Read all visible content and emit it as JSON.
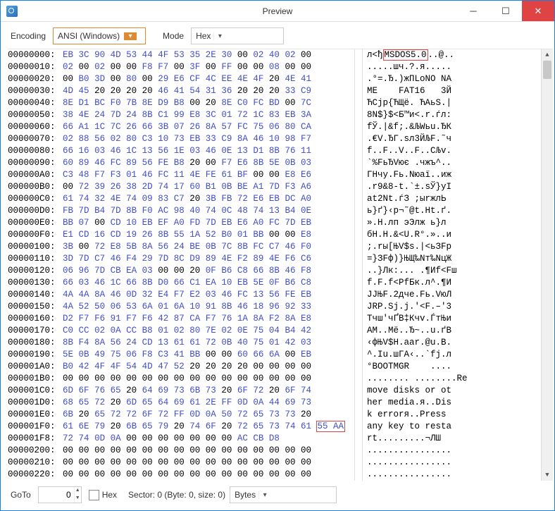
{
  "window": {
    "title": "Preview",
    "minimize_tip": "Minimize",
    "maximize_tip": "Maximize",
    "close_tip": "Close"
  },
  "toolbar": {
    "encoding_label": "Encoding",
    "encoding_value": "ANSI (Windows)",
    "mode_label": "Mode",
    "mode_value": "Hex"
  },
  "footer": {
    "goto_label": "GoTo",
    "goto_value": "0",
    "hex_label": "Hex",
    "sector_label": "Sector: 0 (Byte: 0, size: 0)",
    "unit_value": "Bytes"
  },
  "highlights": {
    "msdos_row_index": 0,
    "msdos_text": "MSDOS5.0",
    "sig_row_index": 31,
    "sig_hex": "55 AA"
  },
  "rows": [
    {
      "o": "00000000:",
      "h": "EB 3C 90 4D 53 44 4F 53  35 2E 30 00 02 40 02 00",
      "a": "л<ђMSDOS5.0..@.."
    },
    {
      "o": "00000010:",
      "h": "02 00 02 00 00 F8 F7 00  3F 00 FF 00 00 08 00 00",
      "a": ".....шч.?.я....."
    },
    {
      "o": "00000020:",
      "h": "00 B0 3D 00 80 00 29 E6  CF 4C EE 4E 4F 20 4E 41",
      "a": ".°=.Ђ.)жПLоNO NA"
    },
    {
      "o": "00000030:",
      "h": "4D 45 20 20 20 20 46 41  54 31 36 20 20 20 33 C9",
      "a": "ME    FAT16   3Й"
    },
    {
      "o": "00000040:",
      "h": "8E D1 BC F0 7B 8E D9 B8  00 20 8E C0 FC BD 00 7C",
      "a": "ЋСjр{ЋЩё. ЋАьS.|"
    },
    {
      "o": "00000050:",
      "h": "38 4E 24 7D 24 8B C1 99  E8 3C 01 72 1C 83 EB 3A",
      "a": "8N$}$<Б™и<.r.ѓл:"
    },
    {
      "o": "00000060:",
      "h": "66 A1 1C 7C 26 66 3B 07  26 8A 57 FC 75 06 80 CA",
      "a": "fЎ.|&f;.&ЉWьu.ЂК"
    },
    {
      "o": "00000070:",
      "h": "02 88 56 02 80 C3 10 73  EB 33 C9 8A 46 10 98 F7",
      "a": ".€V.ЂГ.sл3ЙЉF.˜ч"
    },
    {
      "o": "00000080:",
      "h": "66 16 03 46 1C 13 56 1E  03 46 0E 13 D1 8B 76 11",
      "a": "f..F..V..F..СЉv."
    },
    {
      "o": "00000090:",
      "h": "60 89 46 FC 89 56 FE B8  20 00 F7 E6 8B 5E 0B 03",
      "a": "`%FьЂVює .чжъ^.."
    },
    {
      "o": "000000A0:",
      "h": "C3 48 F7 F3 01 46 FC 11  4E FE 61 BF 00 00 E8 E6",
      "a": "ГHчу.Fь.Nюаї..иж"
    },
    {
      "o": "000000B0:",
      "h": "00 72 39 26 38 2D 74 17  60 B1 0B BE A1 7D F3 A6",
      "a": ".r9&8-t.`±.ѕЎ}уІ"
    },
    {
      "o": "000000C0:",
      "h": "61 74 32 4E 74 09 83 C7  20 3B FB 72 E6 EB DC A0",
      "a": "at2Nt.ѓЗ ;ыrжлЬ "
    },
    {
      "o": "000000D0:",
      "h": "FB 7D B4 7D 8B F0 AC 98  40 74 0C 48 74 13 B4 0E",
      "a": "ь}ґ}‹р¬˜@t.Ht.ґ."
    },
    {
      "o": "000000E0:",
      "h": "BB 07 00 CD 10 EB EF A0  FD 7D EB E6 A0 FC 7D EB",
      "a": "».Н.лп эЭлж ь}л"
    },
    {
      "o": "000000F0:",
      "h": "E1 CD 16 CD 19 26 8B 55  1A 52 B0 01 BB 00 00 E8",
      "a": "бН.Н.&<U.R°.»..и"
    },
    {
      "o": "00000100:",
      "h": "3B 00 72 E8 5B 8A 56 24  BE 0B 7C 8B FC C7 46 F0",
      "a": ";.rы[ЊV$ѕ.|<ьЗFр"
    },
    {
      "o": "00000110:",
      "h": "3D 7D C7 46 F4 29 7D 8C  D9 89 4E F2 89 4E F6 C6",
      "a": "=}ЗFф)}ЊЩ‰Nт‰NцЖ"
    },
    {
      "o": "00000120:",
      "h": "06 96 7D CB EA 03 00 00  20 0F B6 C8 66 8B 46 F8",
      "a": "..}Лк:... .¶Иf<Fш"
    },
    {
      "o": "00000130:",
      "h": "66 03 46 1C 66 8B D0 66  C1 EA 10 EB 5E 0F B6 C8",
      "a": "f.F.f<РfБк.л^.¶И"
    },
    {
      "o": "00000140:",
      "h": "4A 4A 8A 46 0D 32 E4 F7  E2 03 46 FC 13 56 FE EB",
      "a": "JJЊF.2дче.Fь.VюЛ"
    },
    {
      "o": "00000150:",
      "h": "4A 52 50 06 53 6A 01 6A  10 91 8B 46 18 96 92 33",
      "a": "JRP.Sj.j.'<F.–'3"
    },
    {
      "o": "00000160:",
      "h": "D2 F7 F6 91 F7 F6 42 87  CA F7 76 1A 8A F2 8A E8",
      "a": "Тчш'чҐВ‡Кчv.ЃтЊи"
    },
    {
      "o": "00000170:",
      "h": "C0 CC 02 0A CC B8 01 02  80 7E 02 0E 75 04 B4 42",
      "a": "АМ..Мё..Ђ~..u.ґВ"
    },
    {
      "o": "00000180:",
      "h": "8B F4 8A 56 24 CD 13 61  61 72 0B 40 75 01 42 03",
      "a": "‹фЊV$Н.aar.@u.B."
    },
    {
      "o": "00000190:",
      "h": "5E 0B 49 75 06 F8 C3 41  BB 00 00 60 66 6A 00 EB",
      "a": "^.Iu.шГА‹..`fj.л"
    },
    {
      "o": "000001A0:",
      "h": "B0 42 4F 4F 54 4D 47 52  20 20 20 20 00 00 00 00",
      "a": "°BOOTMGR    ...."
    },
    {
      "o": "000001B0:",
      "h": "00 00 00 00 00 00 00 00  00 00 00 00 00 00 00 00",
      "a": "........ ........Re"
    },
    {
      "o": "000001C0:",
      "h": "6D 6F 76 65 20 64 69 73  6B 73 20 6F 72 20 6F 74",
      "a": "move disks or ot"
    },
    {
      "o": "000001D0:",
      "h": "68 65 72 20 6D 65 64 69  61 2E FF 0D 0A 44 69 73",
      "a": "her media.я..Dis"
    },
    {
      "o": "000001E0:",
      "h": "6B 20 65 72 72 6F 72 FF  0D 0A 50 72 65 73 73 20",
      "a": "k errorя..Press "
    },
    {
      "o": "000001F0:",
      "h": "61 6E 79 20 6B 65 79 20  74 6F 20 72 65 73 74 61",
      "a": "any key to resta"
    },
    {
      "o": "000001F8:",
      "h": "72 74 0D 0A 00 00 00 00  00 00 00 AC CB D8 ",
      "a": "rt.........¬ЛШ"
    },
    {
      "o": "00000200:",
      "h": "00 00 00 00 00 00 00 00  00 00 00 00 00 00 00 00",
      "a": "................"
    },
    {
      "o": "00000210:",
      "h": "00 00 00 00 00 00 00 00  00 00 00 00 00 00 00 00",
      "a": "................"
    },
    {
      "o": "00000220:",
      "h": "00 00 00 00 00 00 00 00  00 00 00 00 00 00 00 00",
      "a": "................"
    }
  ]
}
